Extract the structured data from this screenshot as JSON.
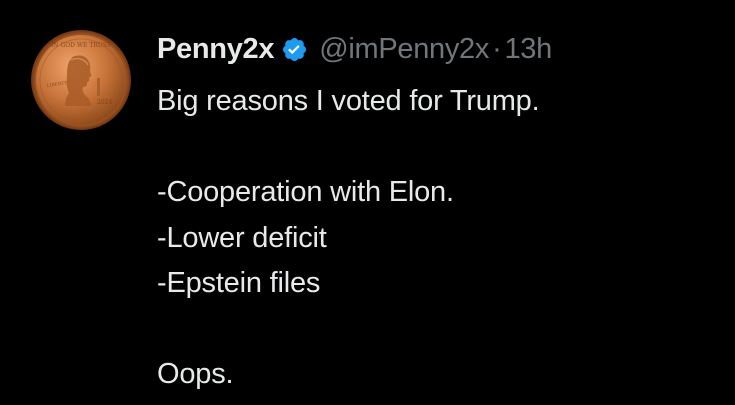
{
  "tweet": {
    "author": {
      "display_name": "Penny2x",
      "handle": "@imPenny2x",
      "verified": true,
      "avatar_icon": "penny-coin-avatar-icon"
    },
    "separator": "·",
    "timestamp": "13h",
    "lines": [
      "Big reasons I voted for Trump.",
      "",
      "-Cooperation with Elon.",
      "-Lower deficit",
      "-Epstein files",
      "",
      "Oops."
    ]
  },
  "colors": {
    "background": "#000000",
    "primary_text": "#e7e9ea",
    "secondary_text": "#71767b",
    "verified_badge": "#1d9bf0",
    "coin_copper": "#c8743a"
  }
}
